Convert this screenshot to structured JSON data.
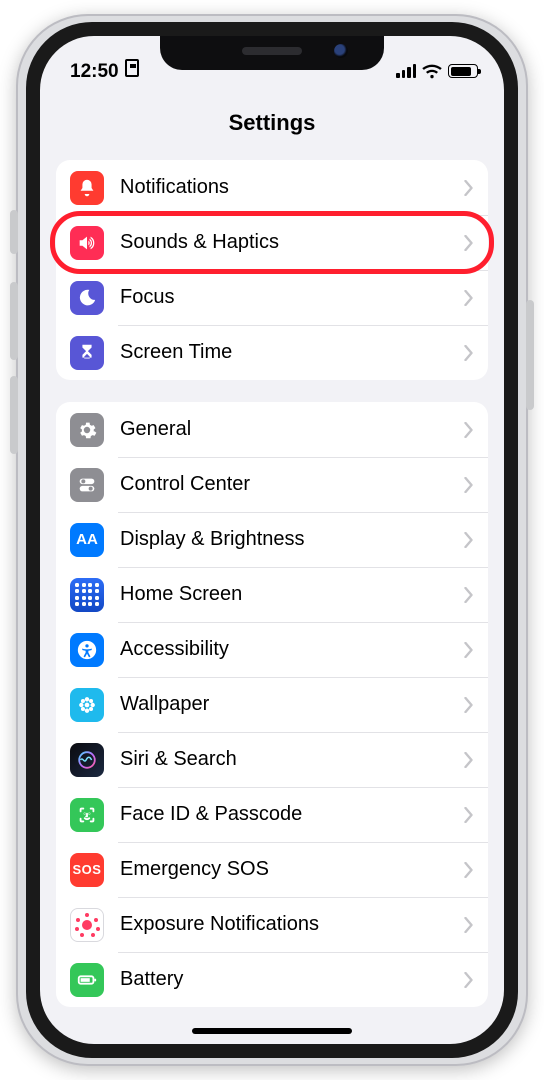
{
  "status": {
    "time": "12:50"
  },
  "header": {
    "title": "Settings"
  },
  "highlightIndex": 1,
  "groups": [
    {
      "rows": [
        {
          "id": "notifications",
          "label": "Notifications",
          "iconName": "bell-icon",
          "iconBg": "bg-red",
          "svg": "bell"
        },
        {
          "id": "sounds-haptics",
          "label": "Sounds & Haptics",
          "iconName": "speaker-icon",
          "iconBg": "bg-pink",
          "svg": "speaker"
        },
        {
          "id": "focus",
          "label": "Focus",
          "iconName": "moon-icon",
          "iconBg": "bg-indigo",
          "svg": "moon"
        },
        {
          "id": "screen-time",
          "label": "Screen Time",
          "iconName": "hourglass-icon",
          "iconBg": "bg-indigo",
          "svg": "hourglass"
        }
      ]
    },
    {
      "rows": [
        {
          "id": "general",
          "label": "General",
          "iconName": "gear-icon",
          "iconBg": "bg-gray",
          "svg": "gear"
        },
        {
          "id": "control-center",
          "label": "Control Center",
          "iconName": "toggles-icon",
          "iconBg": "bg-gray",
          "svg": "toggles"
        },
        {
          "id": "display-brightness",
          "label": "Display & Brightness",
          "iconName": "aa-icon",
          "iconBg": "bg-blue",
          "svg": "aa"
        },
        {
          "id": "home-screen",
          "label": "Home Screen",
          "iconName": "home-grid-icon",
          "iconBg": "bg-home",
          "svg": "homegrid"
        },
        {
          "id": "accessibility",
          "label": "Accessibility",
          "iconName": "accessibility-icon",
          "iconBg": "bg-blue",
          "svg": "accessibility"
        },
        {
          "id": "wallpaper",
          "label": "Wallpaper",
          "iconName": "flower-icon",
          "iconBg": "bg-teal",
          "svg": "flower"
        },
        {
          "id": "siri-search",
          "label": "Siri & Search",
          "iconName": "siri-icon",
          "iconBg": "bg-siri",
          "svg": "siri"
        },
        {
          "id": "face-id-passcode",
          "label": "Face ID & Passcode",
          "iconName": "faceid-icon",
          "iconBg": "bg-green",
          "svg": "faceid"
        },
        {
          "id": "emergency-sos",
          "label": "Emergency SOS",
          "iconName": "sos-icon",
          "iconBg": "bg-red",
          "svg": "sos"
        },
        {
          "id": "exposure-notifications",
          "label": "Exposure Notifications",
          "iconName": "covid-icon",
          "iconBg": "bg-white-box",
          "svg": "covid"
        },
        {
          "id": "battery",
          "label": "Battery",
          "iconName": "battery-icon",
          "iconBg": "bg-green",
          "svg": "battery"
        }
      ]
    }
  ]
}
